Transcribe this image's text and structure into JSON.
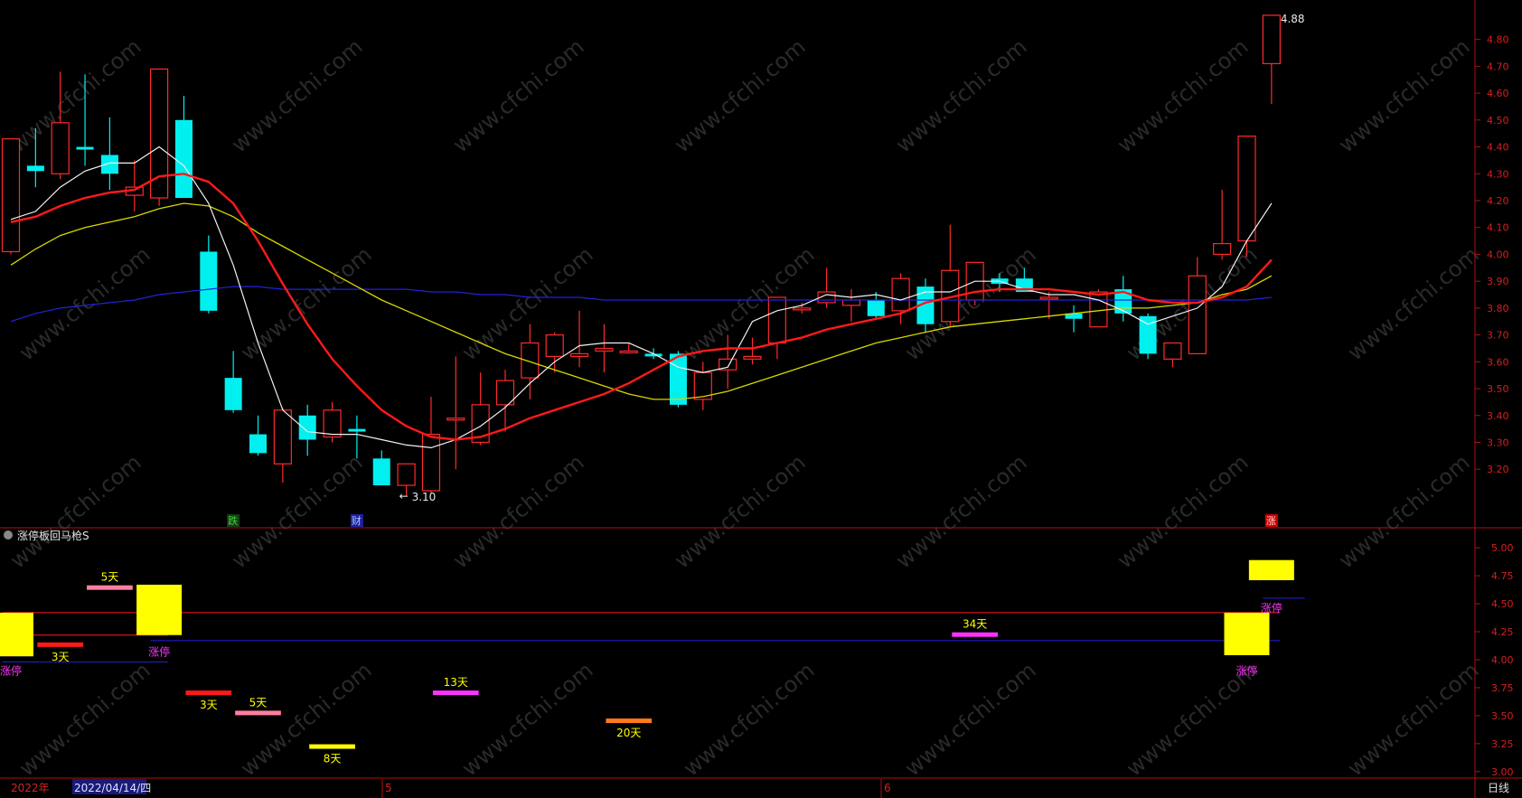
{
  "colors": {
    "bg": "#000000",
    "frame": "#b01010",
    "up": "#ff2a2a",
    "down": "#00f0f0",
    "ma5": "#f2f2f2",
    "ma10": "#ff1a1a",
    "ma20": "#d8d800",
    "ma60": "#2222dd",
    "axis_text": "#d42020",
    "yellow": "#ffff00",
    "magenta": "#ff33ff",
    "pink": "#ff7f9f",
    "orange": "#ff7a1a",
    "marker_red_bg": "#cc0000",
    "marker_blue_bg": "#2020a0",
    "marker_green": "#33dd33"
  },
  "main_chart": {
    "y_ticks": [
      "3.20",
      "3.30",
      "3.40",
      "3.50",
      "3.60",
      "3.70",
      "3.80",
      "3.90",
      "4.00",
      "4.10",
      "4.20",
      "4.30",
      "4.40",
      "4.50",
      "4.60",
      "4.70",
      "4.80"
    ],
    "high_label": "4.88",
    "low_label": "3.10",
    "event_markers": [
      "跌",
      "财",
      "涨"
    ]
  },
  "sub_chart": {
    "title": "涨停板回马枪S",
    "y_ticks": [
      "5.00",
      "4.75",
      "4.50",
      "4.25",
      "4.00",
      "3.75",
      "3.50",
      "3.25",
      "3.00"
    ],
    "labels": [
      "涨停",
      "3天",
      "5天",
      "涨停",
      "3天",
      "5天",
      "8天",
      "13天",
      "20天",
      "34天",
      "涨停",
      "涨停"
    ]
  },
  "bottom_bar": {
    "year": "2022年",
    "cursor_date": "2022/04/14/四",
    "month_5": "5",
    "month_6": "6",
    "period": "日线"
  },
  "watermark": "www.cfchi.com",
  "chart_data": {
    "type": "candlestick",
    "ylim": [
      3.13,
      4.92
    ],
    "candles": [
      {
        "o": 4.01,
        "h": 4.43,
        "l": 4.0,
        "c": 4.43
      },
      {
        "o": 4.33,
        "h": 4.47,
        "l": 4.25,
        "c": 4.31
      },
      {
        "o": 4.3,
        "h": 4.68,
        "l": 4.28,
        "c": 4.49
      },
      {
        "o": 4.4,
        "h": 4.67,
        "l": 4.33,
        "c": 4.39
      },
      {
        "o": 4.37,
        "h": 4.51,
        "l": 4.24,
        "c": 4.3
      },
      {
        "o": 4.22,
        "h": 4.35,
        "l": 4.16,
        "c": 4.25
      },
      {
        "o": 4.21,
        "h": 4.69,
        "l": 4.18,
        "c": 4.69
      },
      {
        "o": 4.5,
        "h": 4.59,
        "l": 4.21,
        "c": 4.21
      },
      {
        "o": 4.01,
        "h": 4.07,
        "l": 3.78,
        "c": 3.79
      },
      {
        "o": 3.54,
        "h": 3.64,
        "l": 3.41,
        "c": 3.42
      },
      {
        "o": 3.33,
        "h": 3.4,
        "l": 3.25,
        "c": 3.26
      },
      {
        "o": 3.22,
        "h": 3.43,
        "l": 3.15,
        "c": 3.42
      },
      {
        "o": 3.4,
        "h": 3.44,
        "l": 3.25,
        "c": 3.31
      },
      {
        "o": 3.32,
        "h": 3.45,
        "l": 3.3,
        "c": 3.42
      },
      {
        "o": 3.35,
        "h": 3.4,
        "l": 3.24,
        "c": 3.34
      },
      {
        "o": 3.24,
        "h": 3.27,
        "l": 3.15,
        "c": 3.14
      },
      {
        "o": 3.14,
        "h": 3.22,
        "l": 3.1,
        "c": 3.22
      },
      {
        "o": 3.12,
        "h": 3.47,
        "l": 3.11,
        "c": 3.33
      },
      {
        "o": 3.39,
        "h": 3.62,
        "l": 3.2,
        "c": 3.39
      },
      {
        "o": 3.3,
        "h": 3.56,
        "l": 3.29,
        "c": 3.44
      },
      {
        "o": 3.44,
        "h": 3.57,
        "l": 3.34,
        "c": 3.53
      },
      {
        "o": 3.54,
        "h": 3.74,
        "l": 3.46,
        "c": 3.67
      },
      {
        "o": 3.62,
        "h": 3.71,
        "l": 3.56,
        "c": 3.7
      },
      {
        "o": 3.62,
        "h": 3.79,
        "l": 3.58,
        "c": 3.63
      },
      {
        "o": 3.64,
        "h": 3.74,
        "l": 3.56,
        "c": 3.65
      },
      {
        "o": 3.64,
        "h": 3.67,
        "l": 3.63,
        "c": 3.64
      },
      {
        "o": 3.63,
        "h": 3.65,
        "l": 3.61,
        "c": 3.62
      },
      {
        "o": 3.63,
        "h": 3.64,
        "l": 3.43,
        "c": 3.44
      },
      {
        "o": 3.46,
        "h": 3.6,
        "l": 3.42,
        "c": 3.56
      },
      {
        "o": 3.57,
        "h": 3.7,
        "l": 3.5,
        "c": 3.61
      },
      {
        "o": 3.61,
        "h": 3.69,
        "l": 3.59,
        "c": 3.62
      },
      {
        "o": 3.67,
        "h": 3.84,
        "l": 3.61,
        "c": 3.84
      },
      {
        "o": 3.8,
        "h": 3.82,
        "l": 3.78,
        "c": 3.8
      },
      {
        "o": 3.82,
        "h": 3.95,
        "l": 3.8,
        "c": 3.86
      },
      {
        "o": 3.81,
        "h": 3.87,
        "l": 3.75,
        "c": 3.83
      },
      {
        "o": 3.83,
        "h": 3.86,
        "l": 3.76,
        "c": 3.77
      },
      {
        "o": 3.79,
        "h": 3.93,
        "l": 3.74,
        "c": 3.91
      },
      {
        "o": 3.88,
        "h": 3.91,
        "l": 3.71,
        "c": 3.74
      },
      {
        "o": 3.75,
        "h": 4.11,
        "l": 3.73,
        "c": 3.94
      },
      {
        "o": 3.83,
        "h": 3.97,
        "l": 3.81,
        "c": 3.97
      },
      {
        "o": 3.91,
        "h": 3.93,
        "l": 3.86,
        "c": 3.89
      },
      {
        "o": 3.91,
        "h": 3.95,
        "l": 3.86,
        "c": 3.86
      },
      {
        "o": 3.84,
        "h": 3.86,
        "l": 3.76,
        "c": 3.84
      },
      {
        "o": 3.78,
        "h": 3.81,
        "l": 3.71,
        "c": 3.76
      },
      {
        "o": 3.73,
        "h": 3.87,
        "l": 3.73,
        "c": 3.86
      },
      {
        "o": 3.87,
        "h": 3.92,
        "l": 3.75,
        "c": 3.78
      },
      {
        "o": 3.77,
        "h": 3.78,
        "l": 3.61,
        "c": 3.63
      },
      {
        "o": 3.61,
        "h": 3.67,
        "l": 3.58,
        "c": 3.67
      },
      {
        "o": 3.63,
        "h": 3.99,
        "l": 3.63,
        "c": 3.92
      },
      {
        "o": 4.0,
        "h": 4.24,
        "l": 3.98,
        "c": 4.04
      },
      {
        "o": 4.05,
        "h": 4.43,
        "l": 3.99,
        "c": 4.44
      },
      {
        "o": 4.71,
        "h": 4.88,
        "l": 4.56,
        "c": 4.89
      }
    ],
    "ma5": [
      4.13,
      4.16,
      4.25,
      4.31,
      4.34,
      4.34,
      4.4,
      4.33,
      4.19,
      3.96,
      3.67,
      3.42,
      3.34,
      3.33,
      3.33,
      3.31,
      3.29,
      3.28,
      3.31,
      3.36,
      3.43,
      3.52,
      3.6,
      3.66,
      3.67,
      3.67,
      3.63,
      3.58,
      3.56,
      3.58,
      3.75,
      3.79,
      3.81,
      3.85,
      3.84,
      3.85,
      3.83,
      3.86,
      3.86,
      3.9,
      3.9,
      3.87,
      3.85,
      3.85,
      3.83,
      3.79,
      3.74,
      3.77,
      3.8,
      3.88,
      4.05,
      4.19
    ],
    "ma10": [
      4.12,
      4.14,
      4.18,
      4.21,
      4.23,
      4.24,
      4.29,
      4.3,
      4.27,
      4.19,
      4.05,
      3.89,
      3.74,
      3.61,
      3.51,
      3.42,
      3.36,
      3.32,
      3.31,
      3.32,
      3.35,
      3.39,
      3.42,
      3.45,
      3.48,
      3.52,
      3.57,
      3.62,
      3.64,
      3.65,
      3.65,
      3.67,
      3.69,
      3.72,
      3.74,
      3.76,
      3.78,
      3.82,
      3.84,
      3.86,
      3.87,
      3.87,
      3.87,
      3.86,
      3.85,
      3.86,
      3.83,
      3.82,
      3.82,
      3.84,
      3.88,
      3.98
    ],
    "ma20": [
      3.96,
      4.02,
      4.07,
      4.1,
      4.12,
      4.14,
      4.17,
      4.19,
      4.18,
      4.14,
      4.08,
      4.03,
      3.98,
      3.93,
      3.88,
      3.83,
      3.79,
      3.75,
      3.71,
      3.67,
      3.63,
      3.6,
      3.57,
      3.54,
      3.51,
      3.48,
      3.46,
      3.46,
      3.47,
      3.49,
      3.52,
      3.55,
      3.58,
      3.61,
      3.64,
      3.67,
      3.69,
      3.71,
      3.73,
      3.74,
      3.75,
      3.76,
      3.77,
      3.78,
      3.79,
      3.8,
      3.8,
      3.81,
      3.82,
      3.85,
      3.87,
      3.92
    ],
    "ma60": [
      3.75,
      3.78,
      3.8,
      3.81,
      3.82,
      3.83,
      3.85,
      3.86,
      3.87,
      3.88,
      3.88,
      3.87,
      3.87,
      3.87,
      3.87,
      3.87,
      3.87,
      3.86,
      3.86,
      3.85,
      3.85,
      3.84,
      3.84,
      3.84,
      3.83,
      3.83,
      3.83,
      3.83,
      3.83,
      3.83,
      3.83,
      3.83,
      3.83,
      3.83,
      3.83,
      3.83,
      3.83,
      3.83,
      3.83,
      3.83,
      3.83,
      3.83,
      3.83,
      3.83,
      3.83,
      3.83,
      3.83,
      3.83,
      3.83,
      3.83,
      3.83,
      3.84
    ],
    "sub": {
      "ylim": [
        2.95,
        5.13
      ],
      "blocks": [
        {
          "i": 0,
          "top": 4.42,
          "bottom": 4.03
        },
        {
          "i": 6,
          "top": 4.67,
          "bottom": 4.22
        },
        {
          "i": 50,
          "top": 4.42,
          "bottom": 4.04
        },
        {
          "i": 51,
          "top": 4.89,
          "bottom": 4.71
        }
      ],
      "segments": [
        {
          "i0": 1,
          "i1": 3,
          "v": 4.13,
          "color": "red",
          "label": "3天",
          "pos": "below"
        },
        {
          "i0": 3,
          "i1": 5,
          "v": 4.64,
          "color": "pink",
          "label": "5天",
          "pos": "above"
        },
        {
          "i0": 7,
          "i1": 9,
          "v": 3.7,
          "color": "red",
          "label": "3天",
          "pos": "below"
        },
        {
          "i0": 9,
          "i1": 11,
          "v": 3.52,
          "color": "pink",
          "label": "5天",
          "pos": "above"
        },
        {
          "i0": 12,
          "i1": 14,
          "v": 3.22,
          "color": "yellow",
          "label": "8天",
          "pos": "below"
        },
        {
          "i0": 17,
          "i1": 19,
          "v": 3.7,
          "color": "magenta",
          "label": "13天",
          "pos": "above"
        },
        {
          "i0": 24,
          "i1": 26,
          "v": 3.45,
          "color": "orange",
          "label": "20天",
          "pos": "below"
        },
        {
          "i0": 38,
          "i1": 40,
          "v": 4.22,
          "color": "magenta",
          "label": "34天",
          "pos": "above"
        }
      ],
      "hlines": [
        {
          "i0": 0,
          "i1": 51,
          "v": 4.42,
          "color": "red"
        },
        {
          "i0": 6,
          "i1": 51,
          "v": 4.17,
          "color": "blue"
        },
        {
          "i0": 0,
          "i1": 6,
          "v": 4.22,
          "color": "red"
        },
        {
          "i0": 0,
          "i1": 6,
          "v": 3.98,
          "color": "blue"
        },
        {
          "i0": 51,
          "i1": 52,
          "v": 4.55,
          "color": "blue"
        }
      ],
      "stop_labels": [
        {
          "i": 0,
          "v": 3.9,
          "text": "涨停"
        },
        {
          "i": 6,
          "v": 4.07,
          "text": "涨停"
        },
        {
          "i": 50,
          "v": 3.9,
          "text": "涨停"
        },
        {
          "i": 51,
          "v": 4.46,
          "text": "涨停"
        }
      ]
    }
  }
}
